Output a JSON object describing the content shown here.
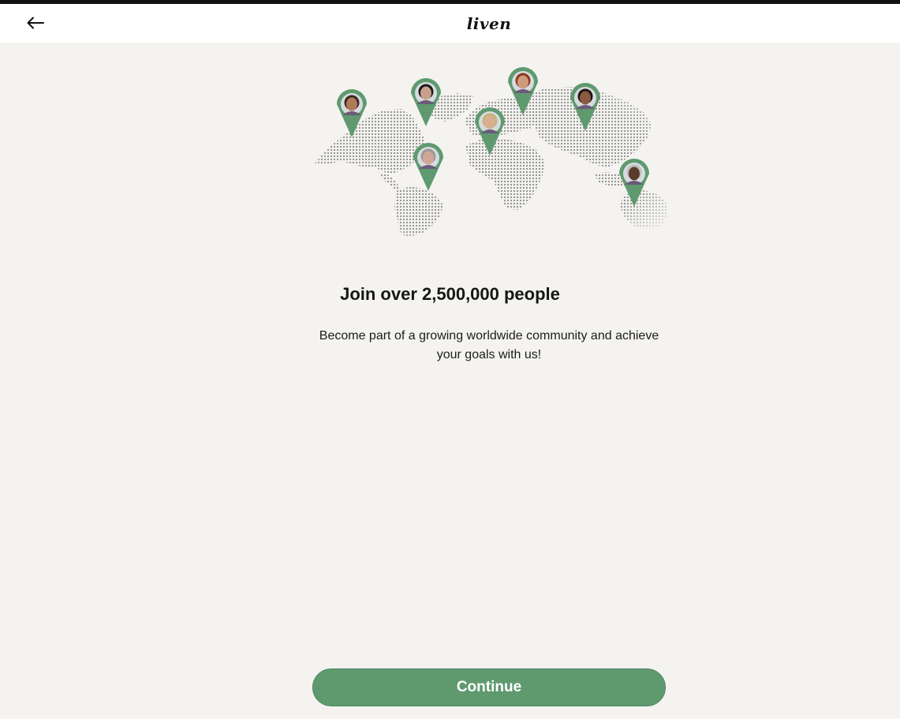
{
  "header": {
    "back_icon": "arrow-left-icon",
    "logo_text": "liven"
  },
  "illustration": {
    "map_icon": "dotted-world-map",
    "pin_color": "#5f9a6f",
    "pins": [
      {
        "name": "pin-north-america"
      },
      {
        "name": "pin-greenland"
      },
      {
        "name": "pin-south-america"
      },
      {
        "name": "pin-africa"
      },
      {
        "name": "pin-europe"
      },
      {
        "name": "pin-asia"
      },
      {
        "name": "pin-australia"
      }
    ]
  },
  "main": {
    "title": "Join over 2,500,000 people",
    "subtitle": "Become part of a growing worldwide community and achieve your goals with us!"
  },
  "footer": {
    "continue_label": "Continue"
  },
  "colors": {
    "background": "#f4f3f0",
    "accent": "#5f9a6f",
    "header_bg": "#ffffff"
  }
}
